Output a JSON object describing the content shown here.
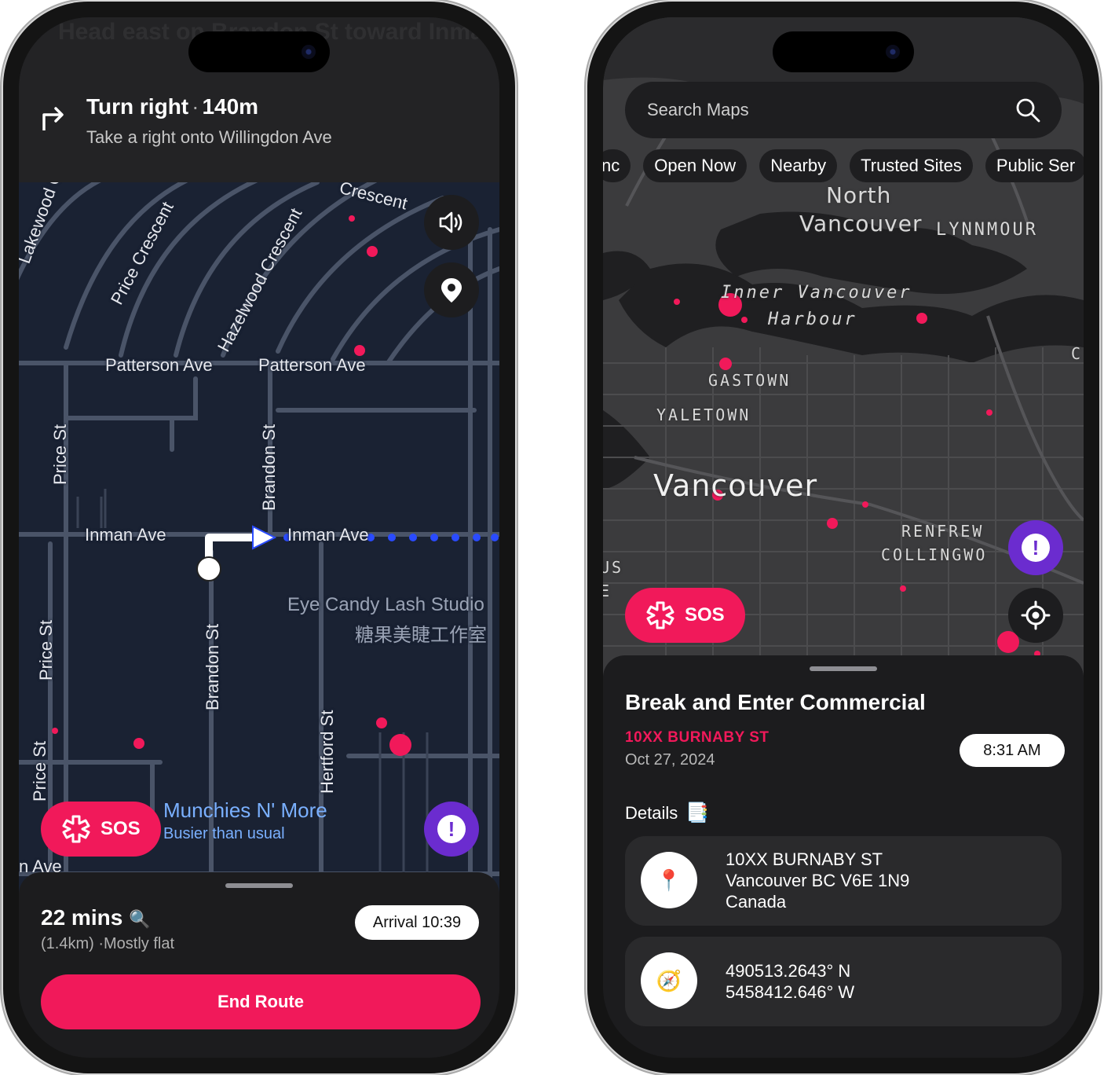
{
  "left_phone": {
    "ghost_instruction": "Head east on Brandon St toward Inman",
    "instruction": {
      "title": "Turn right",
      "distance": "140m",
      "subtitle": "Take a right onto Willingdon Ave"
    },
    "map_labels": {
      "patterson_1": "Patterson Ave",
      "patterson_2": "Patterson Ave",
      "inman_1": "Inman Ave",
      "inman_2": "Inman Ave",
      "price_st_1": "Price St",
      "price_st_2": "Price St",
      "price_st_3": "Price St",
      "brandon_st_1": "Brandon St",
      "brandon_st_2": "Brandon St",
      "hertford_st": "Hertford St",
      "price_crescent": "Price Crescent",
      "hazelwood_crescent": "Hazelwood Crescent",
      "crescent": "Crescent",
      "lakewood": "Lakewood Cr",
      "bottom_ave": "n Ave",
      "business_name": "Eye Candy Lash Studio",
      "business_name_cn": "糖果美睫工作室"
    },
    "poi": {
      "name": "Munchies N' More",
      "status": "Busier than usual"
    },
    "sos_label": "SOS",
    "alert_label": "!",
    "route_summary": {
      "duration": "22 mins",
      "duration_icon": "🔍",
      "details": "(1.4km) ·Mostly flat",
      "arrival": "Arrival 10:39",
      "end_button": "End Route"
    },
    "icons": {
      "turn": "turn-right-arrow-icon",
      "volume": "speaker-icon",
      "pin": "location-pin-icon"
    }
  },
  "right_phone": {
    "search_placeholder": "Search Maps",
    "chips": [
      "Open Now",
      "Nearby",
      "Trusted Sites",
      "Public Ser"
    ],
    "chip_prefix": "nc",
    "map_labels": {
      "north": "North",
      "vancouver_n": "Vancouver",
      "lynnmour": "LYNNMOUR",
      "inner_1": "Inner Vancouver",
      "inner_2": "Harbour",
      "gastown": "GASTOWN",
      "yaletown": "YALETOWN",
      "vancouver": "Vancouver",
      "renfrew": "RENFREW",
      "collingwood": "COLLINGWO",
      "us": "US",
      "e": "E",
      "c": "C"
    },
    "sos_label": "SOS",
    "alert_label": "!",
    "incident": {
      "title": "Break and Enter Commercial",
      "address": "10XX BURNABY ST",
      "date": "Oct 27, 2024",
      "time": "8:31 AM",
      "details_label": "Details",
      "details_icon": "📑",
      "address_lines": [
        "10XX BURNABY ST",
        "Vancouver BC V6E 1N9",
        "Canada"
      ],
      "address_icon": "📍",
      "coordinates": [
        "490513.2643° N",
        "5458412.646° W"
      ],
      "coord_icon": "🧭"
    },
    "colors": {
      "accent": "#f1195a",
      "alert": "#6b2ccf",
      "incident_dot": "#f1195a"
    }
  }
}
